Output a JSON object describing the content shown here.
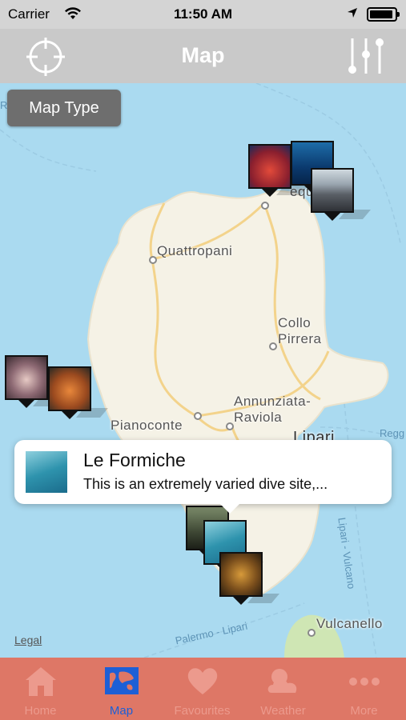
{
  "status_bar": {
    "carrier": "Carrier",
    "time": "11:50 AM"
  },
  "nav": {
    "title": "Map",
    "left_icon": "crosshair-icon",
    "right_icon": "filter-sliders-icon"
  },
  "map": {
    "map_type_button": "Map Type",
    "places": {
      "quattropani": "Quattropani",
      "collo_pirrera": "Collo\nPirrera",
      "annunziata_raviola": "Annunziata-\nRaviola",
      "pianoconte": "Pianoconte",
      "lipari": "Lipari",
      "vulcanello": "Vulcanello",
      "acquacalda_partial": "equa",
      "reggio_partial_left": "Regg",
      "reggio_partial_right": "Regg"
    },
    "sea_routes": {
      "palermo_lipari": "Palermo - Lipari",
      "lipari_vulcano": "Lipari - Vulcano"
    },
    "legal": "Legal"
  },
  "callout": {
    "title": "Le Formiche",
    "subtitle": "This is an extremely varied dive site,..."
  },
  "tabs": [
    {
      "label": "Home",
      "icon": "home-icon",
      "active": false
    },
    {
      "label": "Map",
      "icon": "map-icon",
      "active": true
    },
    {
      "label": "Favourites",
      "icon": "heart-icon",
      "active": false
    },
    {
      "label": "Weather",
      "icon": "weather-icon",
      "active": false
    },
    {
      "label": "More",
      "icon": "more-icon",
      "active": false
    }
  ],
  "colors": {
    "sea": "#aadaf0",
    "land": "#f5f2e6",
    "tab_bar": "#de7766",
    "tab_active": "#1d5fd6",
    "nav_bar": "#c9c9c9"
  }
}
